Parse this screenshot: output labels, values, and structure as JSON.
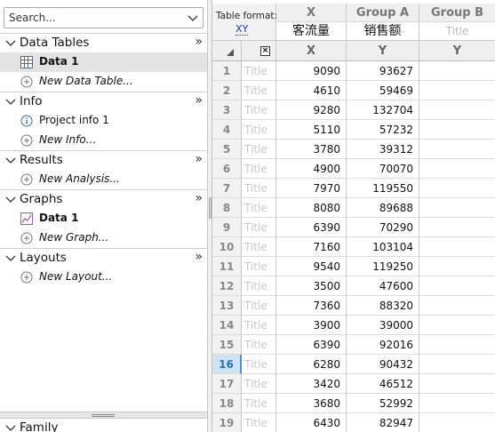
{
  "navigator": {
    "search_placeholder": "Search...",
    "sections": [
      {
        "title": "Data Tables",
        "items": [
          {
            "label": "Data 1",
            "icon": "data-table-icon",
            "bold": true,
            "selected": true
          },
          {
            "label": "New Data Table...",
            "icon": "add-circle-icon",
            "italic": true
          }
        ]
      },
      {
        "title": "Info",
        "items": [
          {
            "label": "Project info 1",
            "icon": "info-icon"
          },
          {
            "label": "New Info...",
            "icon": "add-circle-icon",
            "italic": true
          }
        ]
      },
      {
        "title": "Results",
        "items": [
          {
            "label": "New Analysis...",
            "icon": "add-circle-icon",
            "italic": true
          }
        ]
      },
      {
        "title": "Graphs",
        "items": [
          {
            "label": "Data 1",
            "icon": "graph-icon",
            "bold": true
          },
          {
            "label": "New Graph...",
            "icon": "add-circle-icon",
            "italic": true
          }
        ]
      },
      {
        "title": "Layouts",
        "items": [
          {
            "label": "New Layout...",
            "icon": "add-circle-icon",
            "italic": true
          }
        ]
      }
    ],
    "expand_glyph": "»",
    "family_title": "Family"
  },
  "sheet": {
    "table_format_label": "Table format:",
    "table_format_value": "XY",
    "columns": [
      {
        "group": "X",
        "title": "客流量",
        "sub": "X"
      },
      {
        "group": "Group A",
        "title": "销售额",
        "sub": "Y"
      },
      {
        "group": "Group B",
        "title": "Title",
        "sub": "Y",
        "empty_title": true
      }
    ],
    "close_glyph": "×",
    "row_title_placeholder": "Title",
    "active_row": 16,
    "rows": [
      {
        "n": "1",
        "x": "9090",
        "y": "93627"
      },
      {
        "n": "2",
        "x": "4610",
        "y": "59469"
      },
      {
        "n": "3",
        "x": "9280",
        "y": "132704"
      },
      {
        "n": "4",
        "x": "5110",
        "y": "57232"
      },
      {
        "n": "5",
        "x": "3780",
        "y": "39312"
      },
      {
        "n": "6",
        "x": "4900",
        "y": "70070"
      },
      {
        "n": "7",
        "x": "7970",
        "y": "119550"
      },
      {
        "n": "8",
        "x": "8080",
        "y": "89688"
      },
      {
        "n": "9",
        "x": "6390",
        "y": "70290"
      },
      {
        "n": "10",
        "x": "7160",
        "y": "103104"
      },
      {
        "n": "11",
        "x": "9540",
        "y": "119250"
      },
      {
        "n": "12",
        "x": "3500",
        "y": "47600"
      },
      {
        "n": "13",
        "x": "7360",
        "y": "88320"
      },
      {
        "n": "14",
        "x": "3900",
        "y": "39000"
      },
      {
        "n": "15",
        "x": "6390",
        "y": "92016"
      },
      {
        "n": "16",
        "x": "6280",
        "y": "90432"
      },
      {
        "n": "17",
        "x": "3420",
        "y": "46512"
      },
      {
        "n": "18",
        "x": "3680",
        "y": "52992"
      },
      {
        "n": "19",
        "x": "6430",
        "y": "82947"
      }
    ]
  },
  "colors": {
    "accent_blue": "#2233bb",
    "active_row_bg": "#cde4f7",
    "selected_item_bg": "#e3e3e3"
  }
}
